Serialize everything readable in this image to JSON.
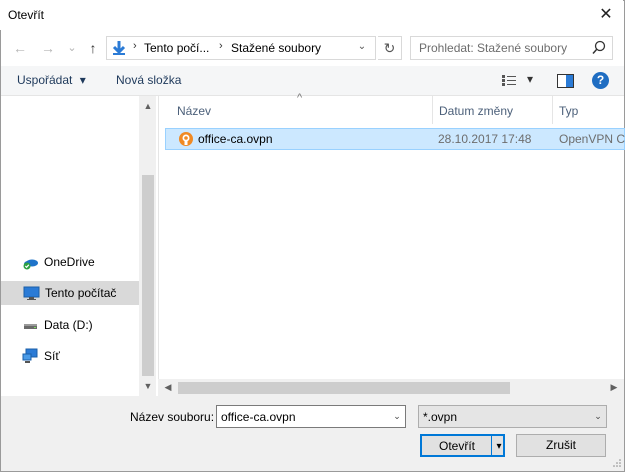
{
  "dialog": {
    "title": "Otevřít",
    "close_glyph": "✕"
  },
  "navigation": {
    "back_glyph": "←",
    "forward_glyph": "→",
    "recent_glyph": "⌄",
    "up_glyph": "↑",
    "breadcrumb": [
      "Tento počí...",
      "Stažené soubory"
    ],
    "separator": "›",
    "dropdown_glyph": "⌄",
    "refresh_glyph": "↻",
    "search_placeholder": "Prohledat: Stažené soubory"
  },
  "toolbar": {
    "organize_label": "Uspořádat",
    "organize_arrow": "▾",
    "new_folder_label": "Nová složka",
    "view_arrow": "▾",
    "help_glyph": "?",
    "help_color": "#1f6dc2"
  },
  "sidebar": {
    "items": [
      {
        "label": "OneDrive",
        "icon": "onedrive-icon",
        "selected": false
      },
      {
        "label": "Tento počítač",
        "icon": "computer-icon",
        "selected": true
      },
      {
        "label": "Data (D:)",
        "icon": "drive-icon",
        "selected": false
      },
      {
        "label": "Síť",
        "icon": "network-icon",
        "selected": false
      }
    ],
    "scroll_up": "▲",
    "scroll_down": "▼"
  },
  "file_list": {
    "columns": [
      "Název",
      "Datum změny",
      "Typ"
    ],
    "sort_glyph": "^",
    "rows": [
      {
        "name": "office-ca.ovpn",
        "date": "28.10.2017 17:48",
        "type": "OpenVPN Co",
        "icon": "openvpn-icon",
        "selected": true
      }
    ],
    "scroll_left": "◀",
    "scroll_right": "▶"
  },
  "footer": {
    "filename_label": "Název souboru:",
    "filename_value": "office-ca.ovpn",
    "filter_value": "*.ovpn",
    "open_label": "Otevřít",
    "open_arrow": "▾",
    "cancel_label": "Zrušit",
    "dd_glyph": "⌄"
  },
  "colors": {
    "selection": "#cce8ff",
    "accent": "#0078d7",
    "nav_selected": "#d9d9d9"
  }
}
